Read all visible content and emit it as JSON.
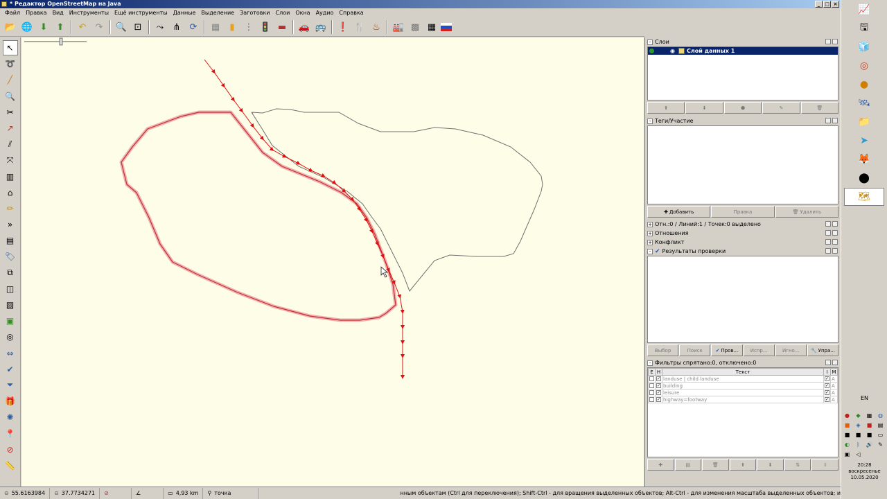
{
  "window": {
    "title": "* Редактор OpenStreetMap на Java"
  },
  "menu": [
    "Файл",
    "Правка",
    "Вид",
    "Инструменты",
    "Ещё инструменты",
    "Данные",
    "Выделение",
    "Заготовки",
    "Слои",
    "Окна",
    "Аудио",
    "Справка"
  ],
  "toolbar_icons": [
    "open-file-icon",
    "open-location-icon",
    "download-icon",
    "upload-icon",
    "undo-icon",
    "redo-icon",
    "preferences-icon",
    "zoom-fit-icon",
    "simplify-icon",
    "split-icon",
    "update-data-icon",
    "separator",
    "preset-wall-icon",
    "preset-road-icon",
    "preset-track-icon",
    "preset-traffic-light-icon",
    "preset-barrier-icon",
    "preset-car-icon",
    "preset-bus-icon",
    "preset-poi-icon",
    "preset-restaurant-icon",
    "preset-landuse-icon",
    "preset-industrial-icon",
    "preset-pattern-icon",
    "preset-grid-icon",
    "preset-flag-icon"
  ],
  "left_tools": [
    "select-tool-icon",
    "lasso-tool-icon",
    "draw-tool-icon",
    "zoom-tool-icon",
    "delete-tool-icon",
    "improve-way-icon",
    "parallel-way-icon",
    "extrude-icon",
    "building-icon",
    "measure-icon",
    "pencil-icon",
    "more-tools-icon",
    "area-icon",
    "tag-icon",
    "relation-icon",
    "layer-icon",
    "validate-icon",
    "photo-icon",
    "filter-icon",
    "blue-arrows-icon",
    "check-icon",
    "funnel-icon",
    "gift-icon",
    "geo-icon",
    "marker-icon",
    "no-entry-icon",
    "ruler-icon"
  ],
  "map": {
    "scale_bar_label": ""
  },
  "status": {
    "lat": "55.6163984",
    "lon": "37.7734271",
    "distance": "4,93 km",
    "mode": "точка",
    "help": "нным объектам (Ctrl для переключения); Shift-Ctrl - для вращения выделенных объектов; Alt-Ctrl - для изменения масштаба выделенных объектов; или для изменения выделения"
  },
  "panels": {
    "layers": {
      "title": "Слои",
      "items": [
        {
          "name": "Слой данных 1",
          "active": true
        }
      ],
      "buttons": [
        "move-up-icon",
        "move-down-icon",
        "merge-icon",
        "edit-icon",
        "delete-icon"
      ]
    },
    "tags": {
      "title": "Теги/Участие",
      "buttons": [
        {
          "label": "Добавить",
          "enabled": true
        },
        {
          "label": "Правка",
          "enabled": false
        },
        {
          "label": "Удалить",
          "enabled": false
        }
      ]
    },
    "selection": {
      "title": "Отн.:0 / Линий:1 / Точек:0 выделено"
    },
    "relations": {
      "title": "Отношения"
    },
    "conflict": {
      "title": "Конфликт"
    },
    "validation": {
      "title": "Результаты проверки",
      "buttons": [
        {
          "label": "Выбор",
          "enabled": false
        },
        {
          "label": "Поиск",
          "enabled": false
        },
        {
          "label": "Пров...",
          "enabled": true
        },
        {
          "label": "Испр...",
          "enabled": false
        },
        {
          "label": "Игно...",
          "enabled": false
        },
        {
          "label": "Упра...",
          "enabled": true
        }
      ]
    },
    "filters": {
      "title": "Фильтры спрятано:0, отключено:0",
      "columns": [
        "E",
        "H",
        "Текст",
        "I",
        "M"
      ],
      "rows": [
        {
          "text": "landuse | child landuse",
          "m": "A"
        },
        {
          "text": "building",
          "m": "A"
        },
        {
          "text": "leisure",
          "m": "A"
        },
        {
          "text": "highway=footway",
          "m": "A"
        }
      ]
    }
  },
  "taskbar": {
    "apps": [
      "spreadsheet-icon",
      "usb-icon",
      "paint-icon",
      "chrome-icon",
      "pdf-icon",
      "satellite-icon",
      "folder-icon",
      "telegram-icon",
      "firefox-icon",
      "obs-icon",
      "josm-icon"
    ],
    "lang": "EN",
    "time": "20:28",
    "day": "воскресенье",
    "date": "10.05.2020"
  }
}
